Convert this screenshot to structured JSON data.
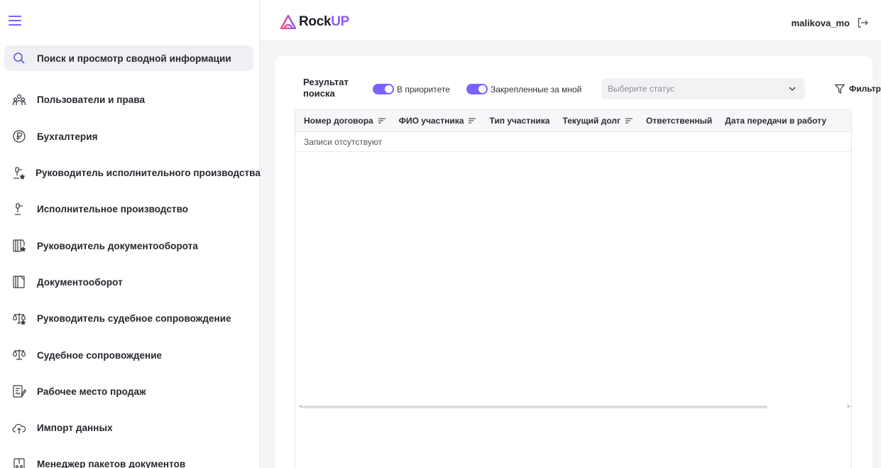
{
  "sidebar": {
    "items": [
      {
        "label": "Поиск и просмотр сводной информации",
        "icon": "search-icon"
      },
      {
        "label": "Пользователи и права",
        "icon": "users-icon"
      },
      {
        "label": "Бухгалтерия",
        "icon": "ruble-icon"
      },
      {
        "label": "Руководитель исполнительного производства",
        "icon": "gavel-star-icon"
      },
      {
        "label": "Исполнительное производство",
        "icon": "gavel-icon"
      },
      {
        "label": "Руководитель документооборота",
        "icon": "documents-star-icon"
      },
      {
        "label": "Документооборот",
        "icon": "documents-icon"
      },
      {
        "label": "Руководитель судебное сопровождение",
        "icon": "scales-star-icon"
      },
      {
        "label": "Судебное сопровождение",
        "icon": "scales-icon"
      },
      {
        "label": "Рабочее место продаж",
        "icon": "sales-doc-icon"
      },
      {
        "label": "Импорт данных",
        "icon": "cloud-upload-icon"
      },
      {
        "label": "Менеджер пакетов документов",
        "icon": "package-icon"
      }
    ]
  },
  "header": {
    "logo_rock": "Rock",
    "logo_up": "UP",
    "username": "malikova_mo"
  },
  "toolbar": {
    "title": "Результат поиска",
    "toggle_priority": "В приоритете",
    "toggle_assigned": "Закрепленные за мной",
    "status_placeholder": "Выберите статус",
    "filter_label": "Фильтр"
  },
  "table": {
    "columns": [
      "Номер договора",
      "ФИО участника",
      "Тип участника",
      "Текущий долг",
      "Ответственный",
      "Дата передачи в работу"
    ],
    "empty_text": "Записи отсутствуют"
  },
  "colors": {
    "accent": "#7b61ff",
    "brand_up": "#8a5cf6"
  }
}
